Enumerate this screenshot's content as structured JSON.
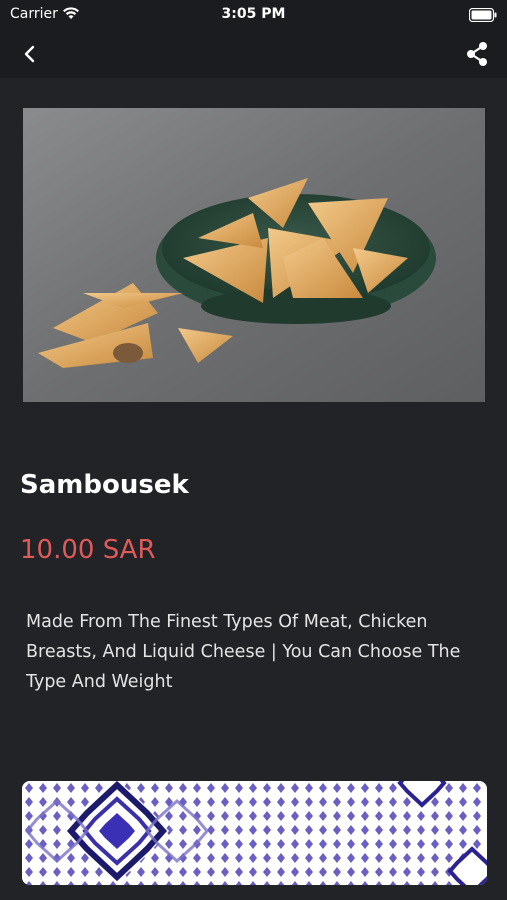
{
  "status_bar": {
    "carrier": "Carrier",
    "time": "3:05 PM"
  },
  "nav": {
    "back_icon": "chevron-left-icon",
    "share_icon": "share-icon"
  },
  "product": {
    "name": "Sambousek",
    "price": "10.00 SAR",
    "description": "Made From The Finest Types Of Meat, Chicken Breasts, And Liquid Cheese | You Can Choose The Type And Weight"
  },
  "colors": {
    "background": "#222326",
    "price": "#e05a5a",
    "banner_pattern": "#5b4fb0"
  }
}
